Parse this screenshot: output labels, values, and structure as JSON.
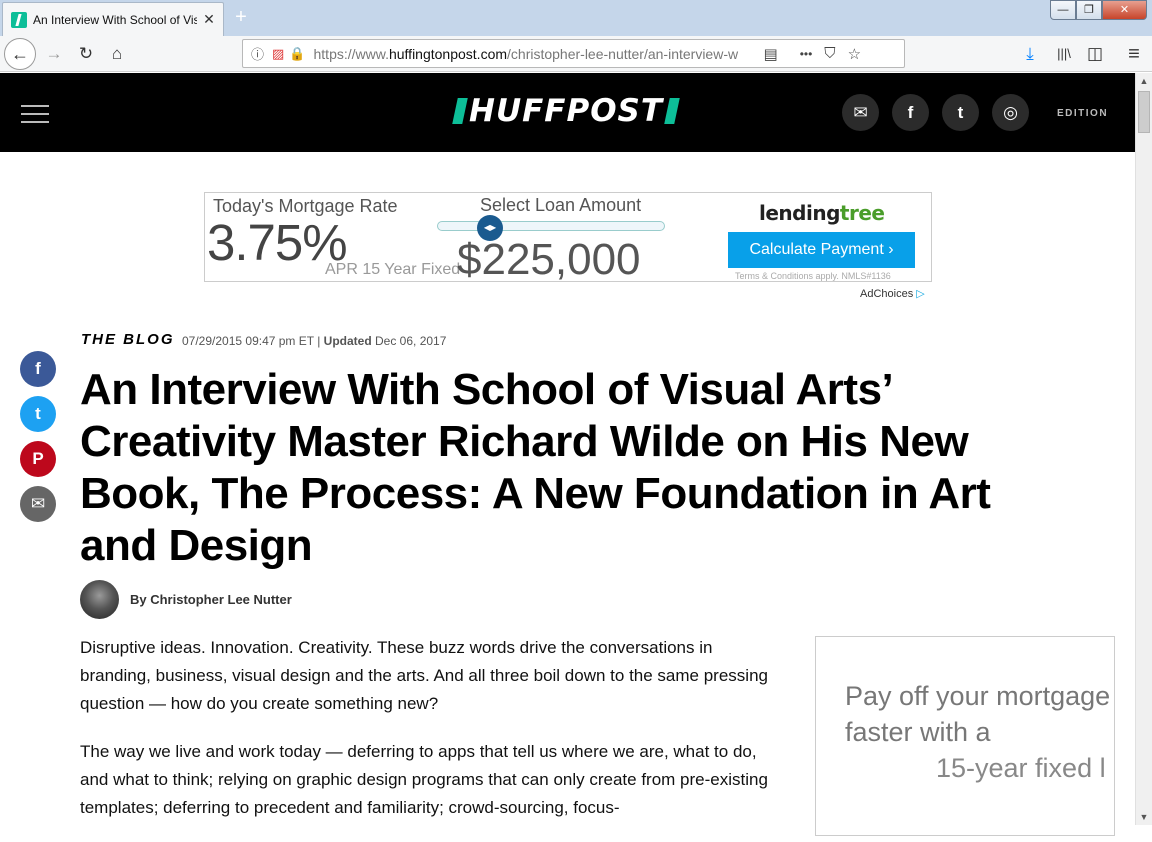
{
  "browser": {
    "tab_title": "An Interview With School of Visual Arts",
    "tab_close": "✕",
    "new_tab": "+",
    "win_min": "—",
    "win_max": "❐",
    "win_close": "✕",
    "url_prefix": "https://www.",
    "url_domain": "huffingtonpost.com",
    "url_path": "/christopher-lee-nutter/an-interview-w",
    "icons": {
      "back": "←",
      "forward": "→",
      "reload": "↻",
      "home": "⌂",
      "info": "ⓘ",
      "lock": "🔒",
      "reader": "▤",
      "more": "•••",
      "pocket": "⛉",
      "star": "☆",
      "download": "⤓",
      "library": "|||\\",
      "sidebar": "◫",
      "menu": "≡"
    }
  },
  "site": {
    "logo": "HUFFPOST",
    "edition": "EDITION",
    "social": {
      "email": "✉",
      "facebook": "f",
      "twitter": "t",
      "instagram": "◎"
    }
  },
  "ad": {
    "rate_label": "Today's Mortgage Rate",
    "rate": "3.75%",
    "apr": "APR 15 Year Fixed",
    "loan_label": "Select Loan Amount",
    "knob": "◀▶",
    "amount": "$225,000",
    "brand_a": "lending",
    "brand_b": "tree",
    "cta": "Calculate Payment  ›",
    "terms": "Terms & Conditions apply. NMLS#1136",
    "adchoices": "AdChoices",
    "adchoices_icon": "▷"
  },
  "article": {
    "section": "THE BLOG",
    "date": "07/29/2015 09:47 pm ET | ",
    "updated_label": "Updated",
    "updated": " Dec 06, 2017",
    "headline": "An Interview With School of Visual Arts’ Creativity Master Richard Wilde on His New Book, The Process: A New Foundation in Art and Design",
    "byline": "By Christopher Lee Nutter",
    "share": {
      "facebook": "f",
      "twitter": "t",
      "pinterest": "P",
      "email": "✉"
    },
    "paragraphs": [
      "Disruptive ideas. Innovation. Creativity. These buzz words drive the conversations in branding, business, visual design and the arts. And all three boil down to the same pressing question — how do you create something new?",
      "The way we live and work today — deferring to apps that tell us where we are, what to do, and what to think; relying on graphic design programs that can only create from pre-existing templates; deferring to precedent and familiarity; crowd-sourcing, focus-"
    ]
  },
  "side_ad": {
    "line1": "Pay off your mortgage",
    "line2": "faster with a",
    "line3": "15-year fixed l"
  },
  "scrollbar": {
    "up": "▲",
    "down": "▼"
  },
  "colors": {
    "brand_green": "#0dbe98",
    "header_bg": "#000000",
    "cta_blue": "#08a0e9",
    "facebook": "#3b5998",
    "twitter": "#1da1f2",
    "pinterest": "#bd081c",
    "email_grey": "#666666"
  }
}
